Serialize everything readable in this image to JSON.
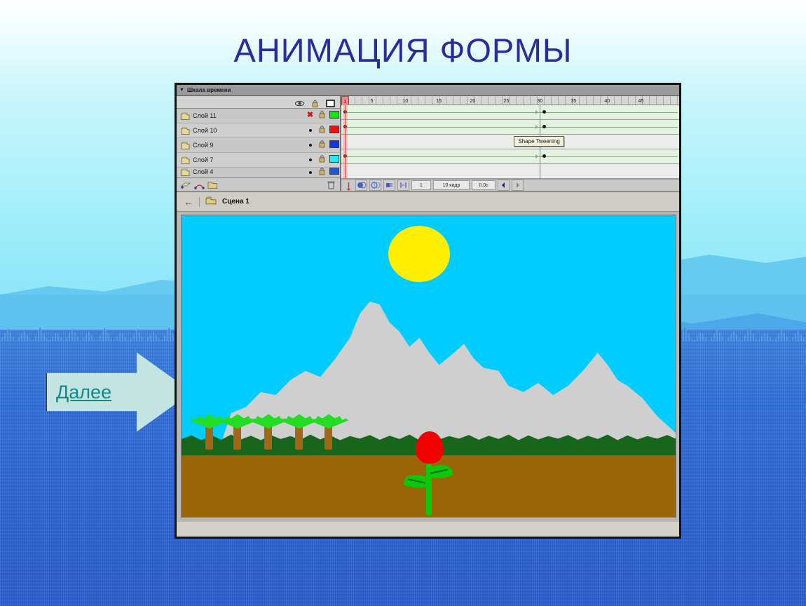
{
  "slide": {
    "title": "АНИМАЦИЯ ФОРМЫ",
    "title_color": "#2b2b9c",
    "background_colors": [
      "#ffffff",
      "#ccf6fb",
      "#63c8ef",
      "#4aa8e8",
      "#2f67d8"
    ]
  },
  "nav": {
    "label": "Далее",
    "link_color": "#0f8a86",
    "arrow_fill": "#c4e4e2"
  },
  "flash": {
    "timeline": {
      "panel_title": "Шкала времени",
      "collapse_triangle": "▼",
      "column_icons": [
        "eye-icon",
        "lock-icon",
        "outline-square-icon"
      ],
      "layers": [
        {
          "name": "Слой 11",
          "visible_marker": "✕",
          "locked": "lock-icon",
          "outline_color": "#00ee00",
          "selected": true
        },
        {
          "name": "Слой 10",
          "visible_marker": "•",
          "locked": "lock-icon",
          "outline_color": "#ee1111",
          "selected": false
        },
        {
          "name": "Слой 9",
          "visible_marker": "•",
          "locked": "lock-icon",
          "outline_color": "#1133ee",
          "selected": false
        },
        {
          "name": "Слой 7",
          "visible_marker": "•",
          "locked": "lock-icon",
          "outline_color": "#22eeee",
          "selected": false
        },
        {
          "name": "Слой 4",
          "visible_marker": "•",
          "locked": "lock-icon",
          "outline_color": "#2255dd",
          "selected": false
        }
      ],
      "footer_buttons": [
        "add-layer-icon",
        "add-motion-guide-icon",
        "add-folder-icon",
        "delete-layer-icon"
      ],
      "ruler_ticks": [
        1,
        5,
        10,
        15,
        20,
        25,
        30,
        35,
        40,
        45
      ],
      "playhead_frame": 1,
      "keyframe_frames": [
        1,
        30
      ],
      "rows": [
        {
          "type": "tween"
        },
        {
          "type": "tween"
        },
        {
          "type": "plain"
        },
        {
          "type": "tween"
        },
        {
          "type": "plain"
        }
      ],
      "tooltip": "Shape Tweening",
      "status": {
        "current_frame": "1",
        "fps": "10 кадр",
        "elapsed": "0.0c"
      },
      "playback_buttons": [
        "onion-skin-icon",
        "onion-skin-outline-icon",
        "edit-multiple-frames-icon",
        "modify-onion-markers-icon"
      ],
      "nav_buttons": [
        "prev-scene-icon",
        "next-scene-icon"
      ]
    },
    "scene_bar": {
      "back_arrow": "←",
      "scene_icon": "scene-icon",
      "scene_name": "Сцена 1"
    },
    "stage": {
      "sky_color": "#00ccff",
      "sun_color": "#ffef00",
      "mountain_color": "#cfcfcf",
      "grass_color": "#17661c",
      "soil_color": "#9a6507",
      "flower_bud_color": "#f20000",
      "stem_color": "#0ac80a",
      "palm_trunk_color": "#a3671a",
      "palm_frond_color": "#22dd22",
      "palm_count": 5
    }
  }
}
